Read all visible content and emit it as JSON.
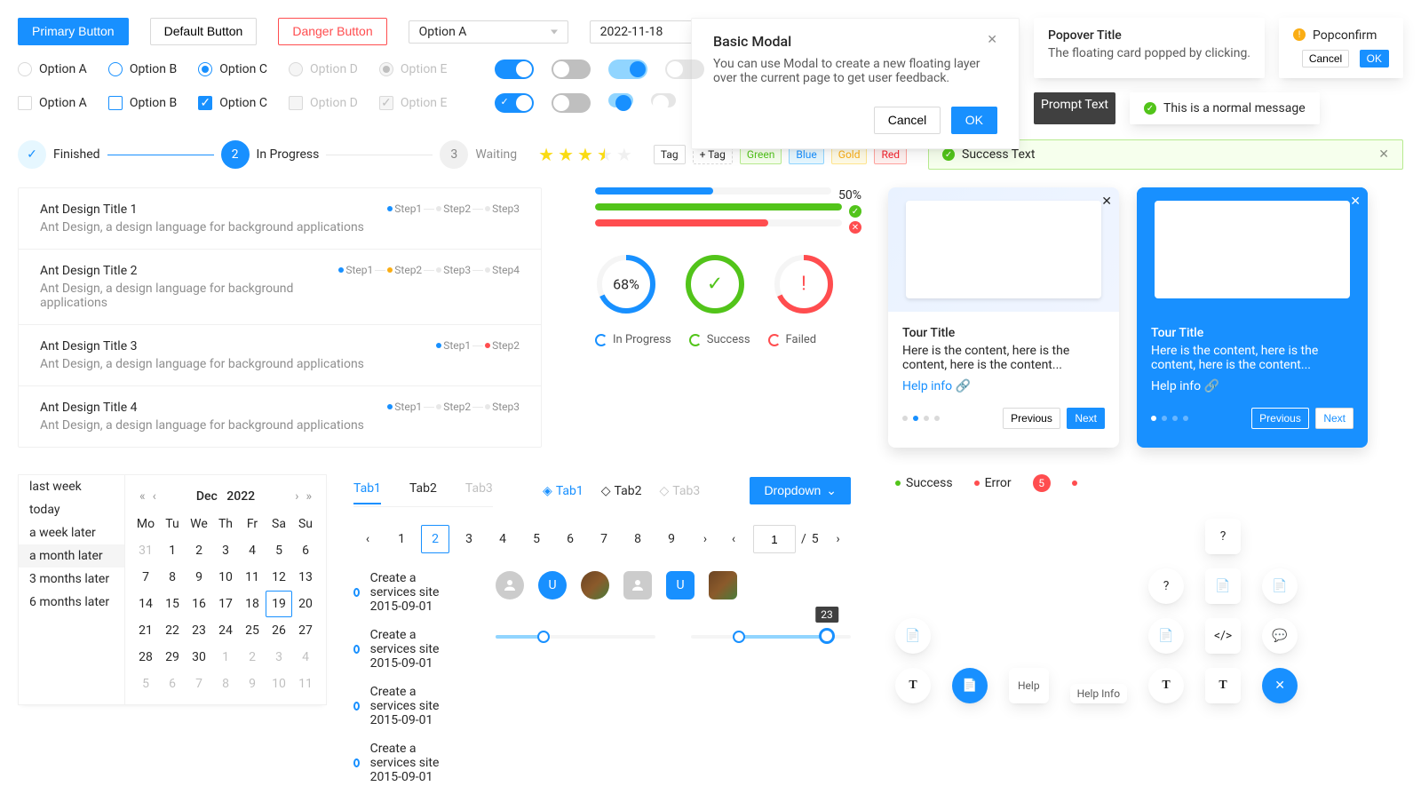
{
  "buttons": {
    "primary": "Primary Button",
    "default": "Default Button",
    "danger": "Danger Button"
  },
  "select": {
    "value": "Option A"
  },
  "datePicker": {
    "value": "2022-11-18"
  },
  "radios": {
    "a": "Option A",
    "b": "Option B",
    "c": "Option C",
    "d": "Option D",
    "e": "Option E"
  },
  "checkboxes": {
    "a": "Option A",
    "b": "Option B",
    "c": "Option C",
    "d": "Option D",
    "e": "Option E"
  },
  "modal": {
    "title": "Basic Modal",
    "body": "You can use Modal to create a new floating layer over the current page to get user feedback.",
    "cancel": "Cancel",
    "ok": "OK"
  },
  "popover": {
    "title": "Popover Title",
    "body": "The floating card popped by clicking."
  },
  "popconfirm": {
    "title": "Popconfirm",
    "cancel": "Cancel",
    "ok": "OK"
  },
  "tooltip": "Prompt Text",
  "message": "This is a normal message",
  "steps": {
    "finished": "Finished",
    "inProgress": "In Progress",
    "waiting": "Waiting",
    "num2": "2",
    "num3": "3"
  },
  "rate": {
    "value": 3.5
  },
  "tags": {
    "plain": "Tag",
    "add": "+ Tag",
    "green": "Green",
    "blue": "Blue",
    "gold": "Gold",
    "red": "Red"
  },
  "alert": "Success Text",
  "list": {
    "items": [
      {
        "title": "Ant Design Title 1",
        "desc": "Ant Design, a design language for background applications",
        "steps": [
          "Step1",
          "Step2",
          "Step3"
        ],
        "active": 1
      },
      {
        "title": "Ant Design Title 2",
        "desc": "Ant Design, a design language for background applications",
        "steps": [
          "Step1",
          "Step2",
          "Step3",
          "Step4"
        ],
        "active": 1,
        "warn": 1
      },
      {
        "title": "Ant Design Title 3",
        "desc": "Ant Design, a design language for background applications",
        "steps": [
          "Step1",
          "Step2"
        ],
        "active": 0,
        "err": 1
      },
      {
        "title": "Ant Design Title 4",
        "desc": "Ant Design, a design language for background applications",
        "steps": [
          "Step1",
          "Step2",
          "Step3"
        ],
        "active": 0
      }
    ]
  },
  "progress": {
    "line1": {
      "percent": 50,
      "label": "50%"
    },
    "line2": {
      "percent": 100,
      "status": "success"
    },
    "line3": {
      "percent": 70,
      "status": "error"
    },
    "circle1": {
      "percent": 68,
      "label": "68%"
    }
  },
  "legend": {
    "progress": "In Progress",
    "success": "Success",
    "failed": "Failed"
  },
  "tour": {
    "title": "Tour Title",
    "body": "Here is the content, here is the content, here is the content...",
    "link": "Help info",
    "prev": "Previous",
    "next": "Next"
  },
  "calendar": {
    "presets": [
      "last week",
      "today",
      "a week later",
      "a month later",
      "3 months later",
      "6 months later"
    ],
    "activePreset": 3,
    "month": "Dec",
    "year": "2022",
    "dow": [
      "Mo",
      "Tu",
      "We",
      "Th",
      "Fr",
      "Sa",
      "Su"
    ],
    "rows": [
      [
        "31",
        "1",
        "2",
        "3",
        "4",
        "5",
        "6"
      ],
      [
        "7",
        "8",
        "9",
        "10",
        "11",
        "12",
        "13"
      ],
      [
        "14",
        "15",
        "16",
        "17",
        "18",
        "19",
        "20"
      ],
      [
        "21",
        "22",
        "23",
        "24",
        "25",
        "26",
        "27"
      ],
      [
        "28",
        "29",
        "30",
        "1",
        "2",
        "3",
        "4"
      ],
      [
        "5",
        "6",
        "7",
        "8",
        "9",
        "10",
        "11"
      ]
    ],
    "today": "19"
  },
  "tabs": {
    "items": [
      "Tab1",
      "Tab2",
      "Tab3"
    ]
  },
  "tabs2": {
    "items": [
      "Tab1",
      "Tab2",
      "Tab3"
    ]
  },
  "dropdown": "Dropdown",
  "pagination": {
    "pages": [
      "1",
      "2",
      "3",
      "4",
      "5",
      "6",
      "7",
      "8",
      "9"
    ],
    "active": 1
  },
  "pagination2": {
    "input": "1",
    "sep": "/",
    "total": "5"
  },
  "timeline": {
    "items": [
      "Create a services site 2015-09-01",
      "Create a services site 2015-09-01",
      "Create a services site 2015-09-01",
      "Create a services site 2015-09-01"
    ]
  },
  "avatars": {
    "letter": "U"
  },
  "slider": {
    "tooltip": "23"
  },
  "status": {
    "success": "Success",
    "error": "Error",
    "count": "5"
  },
  "floatBtn": {
    "help": "Help",
    "helpInfo": "Help Info"
  }
}
